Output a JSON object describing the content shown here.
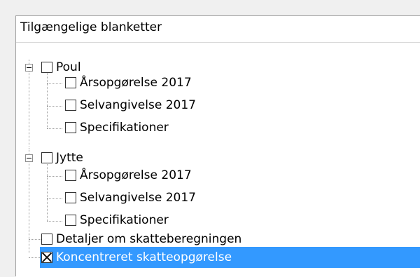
{
  "header": {
    "title": "Tilgængelige blanketter"
  },
  "tree": {
    "items": [
      {
        "label": "Poul",
        "checked": false,
        "expanded": true
      },
      {
        "label": "Årsopgørelse 2017",
        "checked": false
      },
      {
        "label": "Selvangivelse 2017",
        "checked": false
      },
      {
        "label": "Specifikationer",
        "checked": false
      },
      {
        "label": "Jytte",
        "checked": false,
        "expanded": true
      },
      {
        "label": "Årsopgørelse 2017",
        "checked": false
      },
      {
        "label": "Selvangivelse 2017",
        "checked": false
      },
      {
        "label": "Specifikationer",
        "checked": false
      },
      {
        "label": "Detaljer om skatteberegningen",
        "checked": false
      },
      {
        "label": "Koncentreret skatteopgørelse",
        "checked": true,
        "selected": true
      }
    ]
  },
  "colors": {
    "selection": "#3399ff",
    "selection_text": "#ffffff"
  }
}
